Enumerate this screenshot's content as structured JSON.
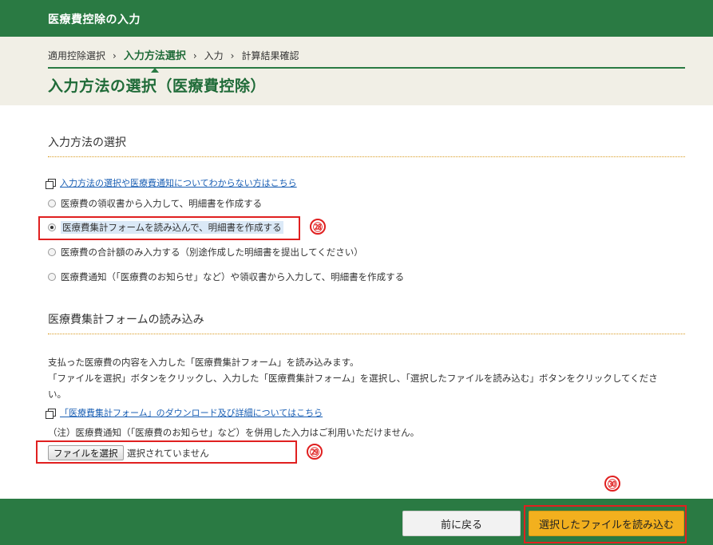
{
  "header": {
    "title": "医療費控除の入力"
  },
  "breadcrumb": {
    "items": [
      "適用控除選択",
      "入力方法選択",
      "入力",
      "計算結果確認"
    ],
    "separator": "›",
    "current_index": 1
  },
  "page": {
    "title": "入力方法の選択（医療費控除）"
  },
  "method_section": {
    "heading": "入力方法の選択",
    "help_link": "入力方法の選択や医療費通知についてわからない方はこちら",
    "options": [
      {
        "label": "医療費の領収書から入力して、明細書を作成する",
        "selected": false
      },
      {
        "label": "医療費集計フォームを読み込んで、明細書を作成する",
        "selected": true
      },
      {
        "label": "医療費の合計額のみ入力する（別途作成した明細書を提出してください）",
        "selected": false
      },
      {
        "label": "医療費通知（「医療費のお知らせ」など）や領収書から入力して、明細書を作成する",
        "selected": false
      }
    ]
  },
  "form_section": {
    "heading": "医療費集計フォームの読み込み",
    "description_line1": "支払った医療費の内容を入力した「医療費集計フォーム」を読み込みます。",
    "description_line2": "「ファイルを選択」ボタンをクリックし、入力した「医療費集計フォーム」を選択し、「選択したファイルを読み込む」ボタンをクリックしてくださ",
    "description_line3": "い。",
    "download_link": "「医療費集計フォーム」のダウンロード及び詳細についてはこちら",
    "note": "（注）医療費通知（「医療費のお知らせ」など）を併用した入力はご利用いただけません。",
    "file_button": "ファイルを選択",
    "file_status": "選択されていません"
  },
  "footer": {
    "back_button": "前に戻る",
    "load_button": "選択したファイルを読み込む"
  },
  "annotations": {
    "badge_1": "㉘",
    "badge_2": "㉙",
    "badge_3": "㉚"
  },
  "colors": {
    "primary_green": "#2a7a43",
    "accent_orange": "#f2b01e",
    "highlight_red": "#e02020",
    "link_blue": "#1a5fb4"
  }
}
